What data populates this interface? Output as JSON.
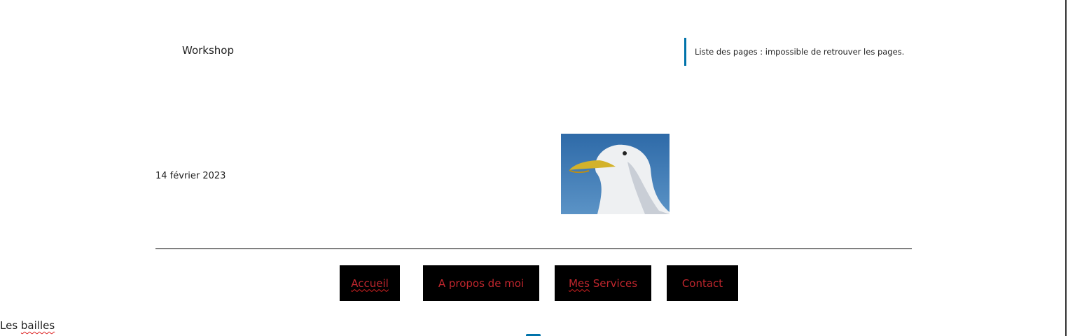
{
  "header": {
    "site_title": "Workshop"
  },
  "notice": {
    "text": "Liste des pages : impossible de retrouver les pages.",
    "accent": "#0073aa"
  },
  "post": {
    "date": "14 février 2023",
    "image": "seagull-photo"
  },
  "nav": {
    "items": [
      {
        "label": "Accueil"
      },
      {
        "label": "A propos de moi"
      },
      {
        "label_misspelled": "Mes",
        "label_rest": " Services"
      },
      {
        "label": "Contact"
      }
    ],
    "text_color": "#c0262d",
    "bg_color": "#000000"
  },
  "footer": {
    "text_before": "Les ",
    "text_misspelled": "bailles"
  }
}
